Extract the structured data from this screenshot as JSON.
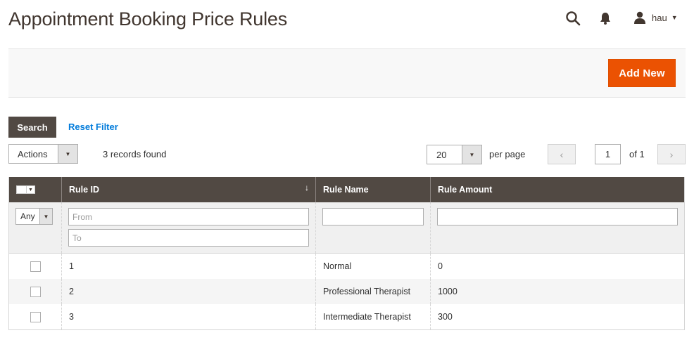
{
  "header": {
    "title": "Appointment Booking Price Rules",
    "user_name": "hau",
    "icons": [
      "search-icon",
      "bell-icon",
      "user-icon"
    ]
  },
  "page_actions": {
    "add_new_label": "Add New"
  },
  "filters": {
    "search_label": "Search",
    "reset_label": "Reset Filter"
  },
  "toolbar": {
    "actions_label": "Actions",
    "records_found": "3 records found",
    "per_page_value": "20",
    "per_page_label": "per page",
    "page_value": "1",
    "of_pages": "of 1"
  },
  "grid": {
    "columns": {
      "rule_id": "Rule ID",
      "rule_name": "Rule Name",
      "rule_amount": "Rule Amount"
    },
    "filter_row": {
      "any_label": "Any",
      "from_placeholder": "From",
      "to_placeholder": "To"
    },
    "rows": [
      {
        "id": "1",
        "name": "Normal",
        "amount": "0"
      },
      {
        "id": "2",
        "name": "Professional Therapist",
        "amount": "1000"
      },
      {
        "id": "3",
        "name": "Intermediate Therapist",
        "amount": "300"
      }
    ]
  },
  "colors": {
    "accent": "#eb5202",
    "header_bg": "#514943",
    "link": "#007bdb"
  }
}
